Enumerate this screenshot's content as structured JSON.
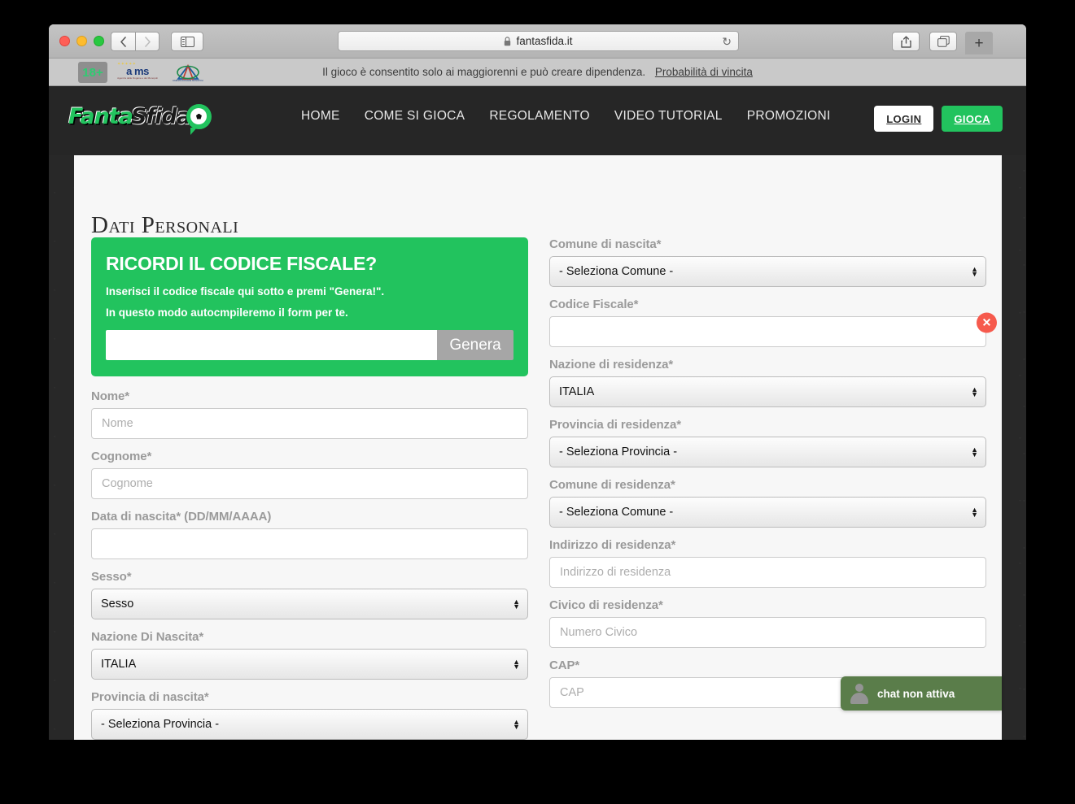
{
  "browser": {
    "url": "fantasfida.it",
    "lock_icon": "lock-icon",
    "reload_icon": "↻",
    "back_icon": "‹",
    "forward_icon": "›",
    "sidebar_icon": "sidebar-icon",
    "share_icon": "share-icon",
    "tabs_icon": "tabs-icon",
    "new_tab_icon": "+"
  },
  "compliance": {
    "age_badge": "18+",
    "aams_label": "a ms",
    "aams_sub": "Agenzia delle Dogane e dei Monopoli",
    "adm_label": "adm-logo",
    "notice": "Il gioco è consentito solo ai maggiorenni e può creare dipendenza.",
    "link": "Probabilità di vincita"
  },
  "header": {
    "logo_part1": "Fanta",
    "logo_part2": "Sfida",
    "nav": [
      {
        "label": "HOME"
      },
      {
        "label": "COME SI GIOCA"
      },
      {
        "label": "REGOLAMENTO"
      },
      {
        "label": "VIDEO TUTORIAL"
      },
      {
        "label": "PROMOZIONI"
      }
    ],
    "login_label": "LOGIN",
    "gioca_label": "GIOCA",
    "accent_green": "#22c35e"
  },
  "page": {
    "title": "Dati Personali"
  },
  "cf_promo": {
    "title": "RICORDI IL CODICE FISCALE?",
    "line1": "Inserisci il codice fiscale qui sotto e premi \"Genera!\".",
    "line2": "In questo modo autocmpileremo il form per te.",
    "input_value": "",
    "input_placeholder": "",
    "button_label": "Genera",
    "background": "#22c35e",
    "button_background": "#a6a6a6"
  },
  "form": {
    "left": [
      {
        "label": "Nome*",
        "type": "text",
        "value": "",
        "placeholder": "Nome",
        "name": "nome"
      },
      {
        "label": "Cognome*",
        "type": "text",
        "value": "",
        "placeholder": "Cognome",
        "name": "cognome"
      },
      {
        "label": "Data di nascita* (DD/MM/AAAA)",
        "type": "text",
        "value": "",
        "placeholder": "",
        "name": "data-di-nascita"
      },
      {
        "label": "Sesso*",
        "type": "select",
        "value": "Sesso",
        "name": "sesso"
      },
      {
        "label": "Nazione Di Nascita*",
        "type": "select",
        "value": "ITALIA",
        "name": "nazione-di-nascita"
      },
      {
        "label": "Provincia di nascita*",
        "type": "select",
        "value": "- Seleziona Provincia -",
        "name": "provincia-di-nascita"
      }
    ],
    "right": [
      {
        "label": "Comune di nascita*",
        "type": "select",
        "value": "- Seleziona Comune -",
        "name": "comune-di-nascita"
      },
      {
        "label": "Codice Fiscale*",
        "type": "text",
        "value": "",
        "placeholder": "",
        "name": "codice-fiscale",
        "error": true
      },
      {
        "label": "Nazione di residenza*",
        "type": "select",
        "value": "ITALIA",
        "name": "nazione-di-residenza"
      },
      {
        "label": "Provincia di residenza*",
        "type": "select",
        "value": "- Seleziona Provincia -",
        "name": "provincia-di-residenza"
      },
      {
        "label": "Comune di residenza*",
        "type": "select",
        "value": "- Seleziona Comune -",
        "name": "comune-di-residenza"
      },
      {
        "label": "Indirizzo di residenza*",
        "type": "text",
        "value": "",
        "placeholder": "Indirizzo di residenza",
        "name": "indirizzo-di-residenza"
      },
      {
        "label": "Civico di residenza*",
        "type": "select",
        "value": "",
        "placeholder": "Numero Civico",
        "type_override": "text",
        "name": "civico-di-residenza"
      },
      {
        "label": "CAP*",
        "type": "text",
        "value": "",
        "placeholder": "CAP",
        "name": "cap"
      }
    ],
    "error_icon": "✕",
    "error_color": "#f65a4d",
    "select_arrows": "▲▼"
  },
  "chat": {
    "label": "chat non attiva",
    "avatar_icon": "person-icon",
    "background": "#5a7d4a"
  }
}
